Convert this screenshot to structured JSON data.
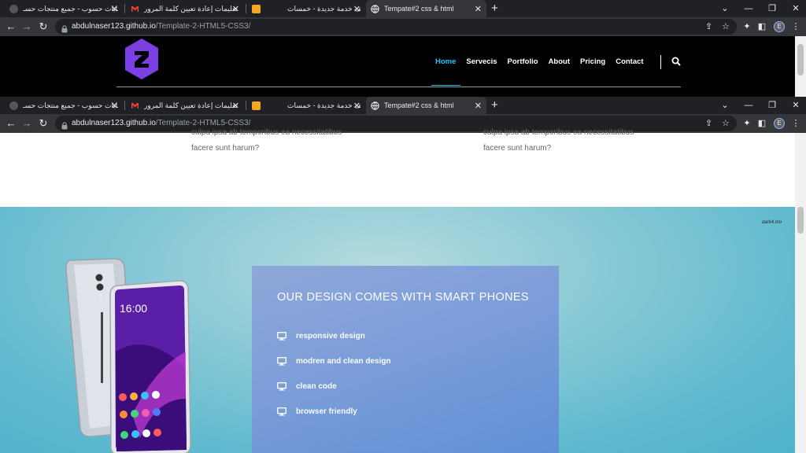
{
  "browser": {
    "tabs": [
      {
        "title": "حسابات حسوب - جميع منتجات حسـ",
        "active": false
      },
      {
        "title": "تعليمات إعادة تعيين كلمة المرور -",
        "active": false
      },
      {
        "title": "أضف خدمة جديدة - خمسات",
        "active": false
      },
      {
        "title": "Tempate#2 css & html",
        "active": true
      }
    ],
    "url_host": "abdulnaser123.github.io",
    "url_path": "/Template-2-HTML5-CSS3/",
    "avatar_letter": "E"
  },
  "site": {
    "nav": [
      "Home",
      "Servecis",
      "Portfolio",
      "About",
      "Pricing",
      "Contact"
    ],
    "active_nav": "Home",
    "accent_color": "#19c8fa",
    "logo_color": "#7b3fe4"
  },
  "features_partial": {
    "left": {
      "line1": "culpa ipsa ab temporibus ea necessitatibus",
      "line2": "facere sunt harum?"
    },
    "right": {
      "line1": "culpa ipsa ab temporibus ea necessitatibus",
      "line2": "facere sunt harum?"
    }
  },
  "design_section": {
    "watermark": "dark4.mo",
    "title": "OUR DESIGN COMES WITH SMART PHONES",
    "phone_time": "16:00",
    "features": [
      "responsive design",
      "modren and clean design",
      "clean code",
      "browser friendly"
    ],
    "icon": "monitor-icon"
  }
}
